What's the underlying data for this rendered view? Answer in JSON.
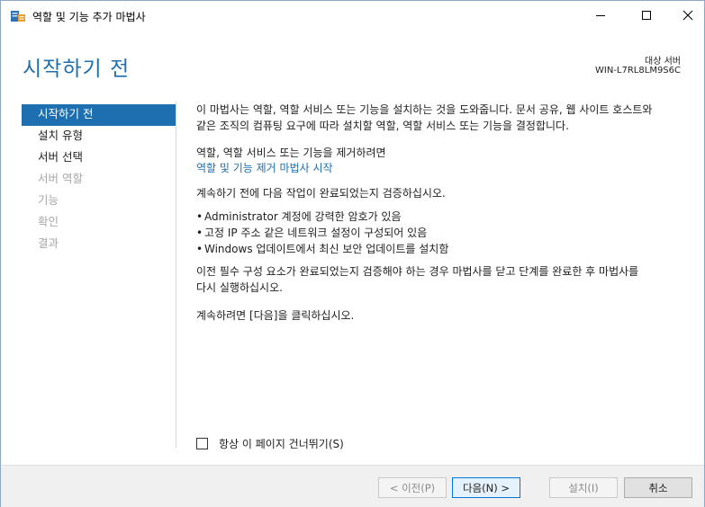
{
  "window": {
    "title": "역할 및 기능 추가 마법사",
    "icons": {
      "app": "server-manager-icon",
      "minimize": "minimize-icon",
      "maximize": "maximize-icon",
      "close": "close-icon"
    }
  },
  "header": {
    "page_title": "시작하기 전",
    "server_label": "대상 서버",
    "server_name": "WIN-L7RL8LM9S6C"
  },
  "nav": {
    "items": [
      {
        "label": "시작하기 전",
        "state": "active"
      },
      {
        "label": "설치 유형",
        "state": "enabled"
      },
      {
        "label": "서버 선택",
        "state": "enabled"
      },
      {
        "label": "서버 역할",
        "state": "disabled"
      },
      {
        "label": "기능",
        "state": "disabled"
      },
      {
        "label": "확인",
        "state": "disabled"
      },
      {
        "label": "결과",
        "state": "disabled"
      }
    ]
  },
  "content": {
    "intro_line1": "이 마법사는 역할, 역할 서비스 또는 기능을 설치하는 것을 도와줍니다. 문서 공유, 웹 사이트 호스트와",
    "intro_line2": "같은 조직의 컴퓨팅 요구에 따라 설치할 역할, 역할 서비스 또는 기능을 결정합니다.",
    "remove_text": "역할, 역할 서비스 또는 기능을 제거하려면",
    "remove_link": "역할 및 기능 제거 마법사 시작",
    "verify_text": "계속하기 전에 다음 작업이 완료되었는지 검증하십시오.",
    "bullets": [
      "Administrator 계정에 강력한 암호가 있음",
      "고정 IP 주소 같은 네트워크 설정이 구성되어 있음",
      "Windows 업데이트에서 최신 보안 업데이트를 설치함"
    ],
    "close_line1": "이전 필수 구성 요소가 완료되었는지 검증해야 하는 경우 마법사를 닫고 단계를 완료한 후 마법사를",
    "close_line2": "다시 실행하십시오.",
    "next_text": "계속하려면 [다음]을 클릭하십시오."
  },
  "skip_checkbox": {
    "label": "항상 이 페이지 건너뛰기(S)",
    "checked": false
  },
  "footer": {
    "prev_label": "< 이전(P)",
    "next_label": "다음(N) >",
    "install_label": "설치(I)",
    "cancel_label": "취소"
  }
}
